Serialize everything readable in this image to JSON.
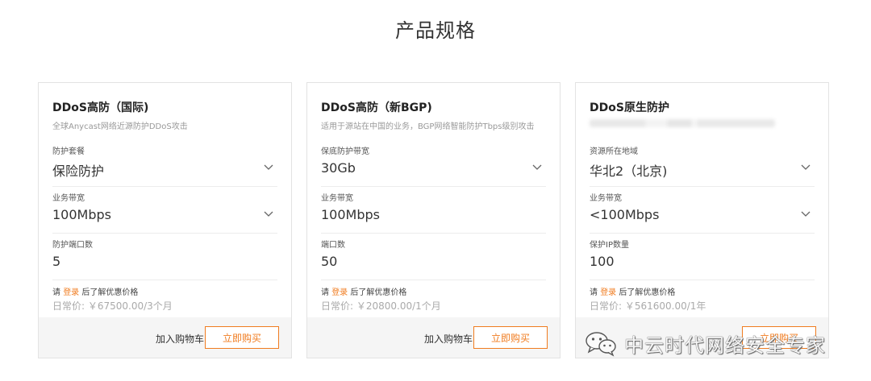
{
  "page": {
    "title": "产品规格"
  },
  "cards": [
    {
      "title": "DDoS高防（国际)",
      "subtitle": "全球Anycast网络近源防护DDoS攻击",
      "fields": [
        {
          "label": "防护套餐",
          "value": "保险防护",
          "dropdown": true
        },
        {
          "label": "业务带宽",
          "value": "100Mbps",
          "dropdown": true
        },
        {
          "label": "防护端口数",
          "value": "5",
          "dropdown": false
        }
      ],
      "login_prefix": "请",
      "login_link": "登录",
      "login_suffix": "后了解优惠价格",
      "daily_price": "日常价: ￥67500.00/3个月",
      "add_cart": "加入购物车",
      "buy_now": "立即购买"
    },
    {
      "title": "DDoS高防（新BGP)",
      "subtitle": "适用于源站在中国的业务，BGP网络智能防护Tbps级别攻击",
      "fields": [
        {
          "label": "保底防护带宽",
          "value": "30Gb",
          "dropdown": true
        },
        {
          "label": "业务带宽",
          "value": "100Mbps",
          "dropdown": false
        },
        {
          "label": "端口数",
          "value": "50",
          "dropdown": false
        }
      ],
      "login_prefix": "请",
      "login_link": "登录",
      "login_suffix": "后了解优惠价格",
      "daily_price": "日常价: ￥20800.00/1个月",
      "add_cart": "加入购物车",
      "buy_now": "立即购买"
    },
    {
      "title": "DDoS原生防护",
      "subtitle": "",
      "fields": [
        {
          "label": "资源所在地域",
          "value": "华北2（北京)",
          "dropdown": true
        },
        {
          "label": "业务带宽",
          "value": "<100Mbps",
          "dropdown": true
        },
        {
          "label": "保护IP数量",
          "value": "100",
          "dropdown": false
        }
      ],
      "login_prefix": "请",
      "login_link": "登录",
      "login_suffix": "后了解优惠价格",
      "daily_price": "日常价: ￥561600.00/1年",
      "add_cart": "",
      "buy_now": "立即购买"
    }
  ],
  "watermark": {
    "text": "中云时代网络安全专家",
    "icon": "wechat-icon"
  },
  "colors": {
    "accent": "#f07c20",
    "footer_bg": "#f5f5f5",
    "border": "#e3e3e3"
  }
}
